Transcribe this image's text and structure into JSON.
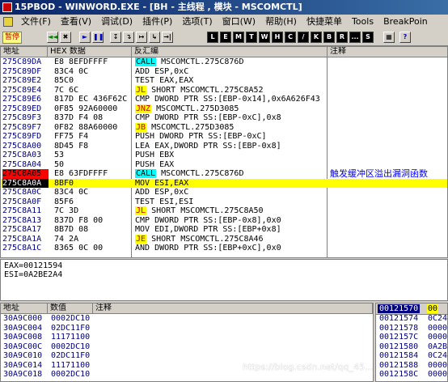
{
  "window": {
    "title": "15PBOD - WINWORD.EXE - [BH - 主线程 , 模块 - MSCOMCTL]"
  },
  "menu": [
    "文件(F)",
    "查看(V)",
    "调试(D)",
    "插件(P)",
    "选项(T)",
    "窗口(W)",
    "帮助(H)",
    "快捷菜单",
    "Tools",
    "BreakPoin"
  ],
  "toolbar": {
    "status": "暂停",
    "buttons": [
      "◄◄",
      "✖",
      "►",
      "❚❚",
      "↧",
      "↴",
      "↦",
      "↳",
      "→|",
      "L",
      "E",
      "M",
      "T",
      "W",
      "H",
      "C",
      "/",
      "K",
      "B",
      "R",
      "...",
      "S",
      "▦",
      "?"
    ]
  },
  "cpu": {
    "headers": {
      "address": "地址",
      "hex": "HEX 数据",
      "disasm": "反汇编",
      "comment": "注释"
    },
    "rows": [
      {
        "addr": "275C89DA",
        "hex": "E8 8EFDFFFF",
        "mn": "CALL",
        "ops": " MSCOMCTL.275C876D",
        "kw": "call"
      },
      {
        "addr": "275C89DF",
        "hex": "83C4 0C",
        "mn": "",
        "ops": "ADD ESP,0xC"
      },
      {
        "addr": "275C89E2",
        "hex": "85C0",
        "mn": "",
        "ops": "TEST EAX,EAX"
      },
      {
        "addr": "275C89E4",
        "hex": "7C 6C",
        "mn": "JL",
        "ops": " SHORT MSCOMCTL.275C8A52",
        "kw": "jl"
      },
      {
        "addr": "275C89E6",
        "hex": "817D EC 436F62C",
        "mn": "",
        "ops": "CMP DWORD PTR SS:[EBP-0x14],0x6A626F43"
      },
      {
        "addr": "275C89ED",
        "hex": "0F85 92A60000",
        "mn": "JNZ",
        "ops": " MSCOMCTL.275D3085",
        "kw": "jnz"
      },
      {
        "addr": "275C89F3",
        "hex": "837D F4 08",
        "mn": "",
        "ops": "CMP DWORD PTR SS:[EBP-0xC],0x8"
      },
      {
        "addr": "275C89F7",
        "hex": "0F82 88A60000",
        "mn": "JB",
        "ops": " MSCOMCTL.275D3085",
        "kw": "jb"
      },
      {
        "addr": "275C89FD",
        "hex": "FF75 F4",
        "mn": "",
        "ops": "PUSH DWORD PTR SS:[EBP-0xC]"
      },
      {
        "addr": "275C8A00",
        "hex": "8D45 F8",
        "mn": "",
        "ops": "LEA EAX,DWORD PTR SS:[EBP-0x8]"
      },
      {
        "addr": "275C8A03",
        "hex": "53",
        "mn": "",
        "ops": "PUSH EBX"
      },
      {
        "addr": "275C8A04",
        "hex": "50",
        "mn": "",
        "ops": "PUSH EAX"
      },
      {
        "addr": "275C8A05",
        "hex": "E8 63FDFFFF",
        "mn": "CALL",
        "ops": " MSCOMCTL.275C876D",
        "kw": "call",
        "bp": true,
        "comment": "触发缓冲区溢出漏洞函数"
      },
      {
        "addr": "275C8A0A",
        "hex": "8BF0",
        "mn": "",
        "ops": "MOV ESI,EAX",
        "sel": true,
        "cur": true
      },
      {
        "addr": "275C8A0C",
        "hex": "83C4 0C",
        "mn": "",
        "ops": "ADD ESP,0xC"
      },
      {
        "addr": "275C8A0F",
        "hex": "85F6",
        "mn": "",
        "ops": "TEST ESI,ESI"
      },
      {
        "addr": "275C8A11",
        "hex": "7C 3D",
        "mn": "JL",
        "ops": " SHORT MSCOMCTL.275C8A50",
        "kw": "jl"
      },
      {
        "addr": "275C8A13",
        "hex": "837D F8 00",
        "mn": "",
        "ops": "CMP DWORD PTR SS:[EBP-0x8],0x0"
      },
      {
        "addr": "275C8A17",
        "hex": "8B7D 08",
        "mn": "",
        "ops": "MOV EDI,DWORD PTR SS:[EBP+0x8]"
      },
      {
        "addr": "275C8A1A",
        "hex": "74 2A",
        "mn": "JE",
        "ops": " SHORT MSCOMCTL.275C8A46",
        "kw": "je"
      },
      {
        "addr": "275C8A1C",
        "hex": "8365 0C 00",
        "mn": "",
        "ops": "AND DWORD PTR SS:[EBP+0xC],0x0"
      }
    ]
  },
  "registers": {
    "line1": "EAX=00121594",
    "line2": "ESI=0A2BE2A4"
  },
  "dump": {
    "headers": {
      "address": "地址",
      "value": "数值",
      "comment": "注释"
    },
    "rows": [
      {
        "addr": "30A9C000",
        "val": "0002DC10"
      },
      {
        "addr": "30A9C004",
        "val": "02DC11F0"
      },
      {
        "addr": "30A9C008",
        "val": "11171100"
      },
      {
        "addr": "30A9C00C",
        "val": "0002DC10"
      },
      {
        "addr": "30A9C010",
        "val": "02DC11F0"
      },
      {
        "addr": "30A9C014",
        "val": "11171100"
      },
      {
        "addr": "30A9C018",
        "val": "0002DC10"
      }
    ]
  },
  "stack": {
    "top_addr": "00121570",
    "top_val": "00",
    "rows": [
      {
        "addr": "00121574",
        "val": "0C24"
      },
      {
        "addr": "00121578",
        "val": "0000"
      },
      {
        "addr": "0012157C",
        "val": "0000"
      },
      {
        "addr": "00121580",
        "val": "0A2B"
      },
      {
        "addr": "00121584",
        "val": "0C24"
      },
      {
        "addr": "00121588",
        "val": "0000"
      },
      {
        "addr": "0012158C",
        "val": "0000"
      }
    ]
  },
  "watermark": "https://blog.csdn.net/qq_45..."
}
